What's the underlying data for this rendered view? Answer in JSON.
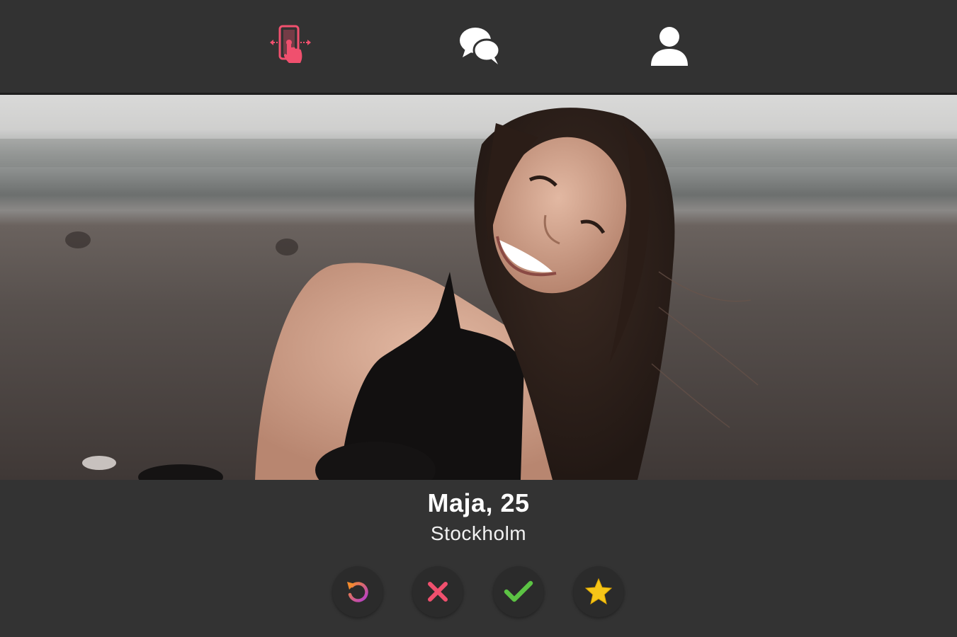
{
  "nav": {
    "items": [
      {
        "id": "swipe",
        "icon": "swipe-phone-icon",
        "active": true
      },
      {
        "id": "chat",
        "icon": "chat-bubbles-icon",
        "active": false
      },
      {
        "id": "profile",
        "icon": "user-profile-icon",
        "active": false
      }
    ]
  },
  "colors": {
    "accent": "#f0506e",
    "background": "#333333",
    "topbar": "#323232",
    "text": "#ffffff",
    "nope": "#f0506e",
    "like": "#5cc344",
    "star": "#f5c518"
  },
  "card": {
    "photo_count": 2,
    "current_photo": 1
  },
  "profile": {
    "name_age": "Maja, 25",
    "city": "Stockholm"
  },
  "actions": [
    {
      "id": "undo",
      "icon": "undo-icon"
    },
    {
      "id": "nope",
      "icon": "close-x-icon"
    },
    {
      "id": "like",
      "icon": "checkmark-icon"
    },
    {
      "id": "super-like",
      "icon": "star-icon"
    }
  ]
}
